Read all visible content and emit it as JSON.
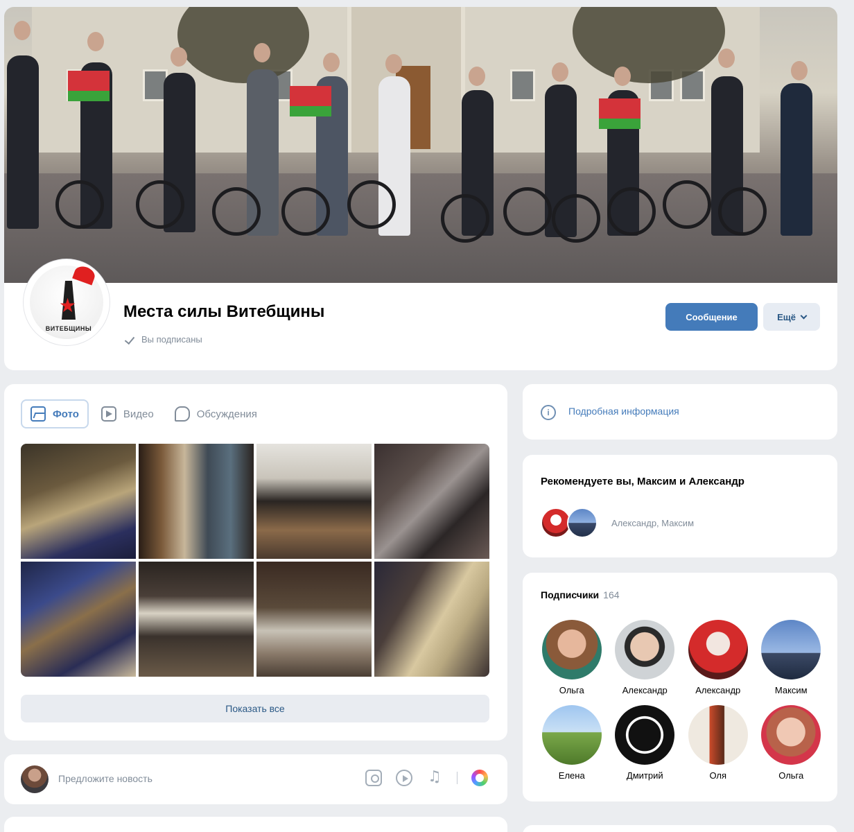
{
  "group": {
    "title": "Места силы Витебщины",
    "subscribed_label": "Вы подписаны",
    "avatar_caption": "ВИТЕБЩИНЫ",
    "message_button": "Сообщение",
    "more_button": "Ещё"
  },
  "media": {
    "tabs": [
      {
        "label": "Фото",
        "icon": "photo-icon",
        "active": true
      },
      {
        "label": "Видео",
        "icon": "video-icon",
        "active": false
      },
      {
        "label": "Обсуждения",
        "icon": "chat-icon",
        "active": false
      }
    ],
    "show_all": "Показать все"
  },
  "suggest": {
    "placeholder": "Предложите новость"
  },
  "info": {
    "label": "Подробная информация"
  },
  "recommend": {
    "title": "Рекомендуете вы, Максим и Александр",
    "names": "Александр, Максим"
  },
  "subscribers": {
    "title": "Подписчики",
    "count": "164",
    "people": [
      {
        "name": "Ольга"
      },
      {
        "name": "Александр"
      },
      {
        "name": "Александр"
      },
      {
        "name": "Максим"
      },
      {
        "name": "Елена"
      },
      {
        "name": "Дмитрий"
      },
      {
        "name": "Оля"
      },
      {
        "name": "Ольга"
      }
    ]
  },
  "colors": {
    "accent": "#447bba",
    "link": "#2a5885",
    "muted": "#818c99",
    "background": "#ebedf0",
    "flag_red": "#d4333a",
    "flag_green": "#3aa33a"
  }
}
